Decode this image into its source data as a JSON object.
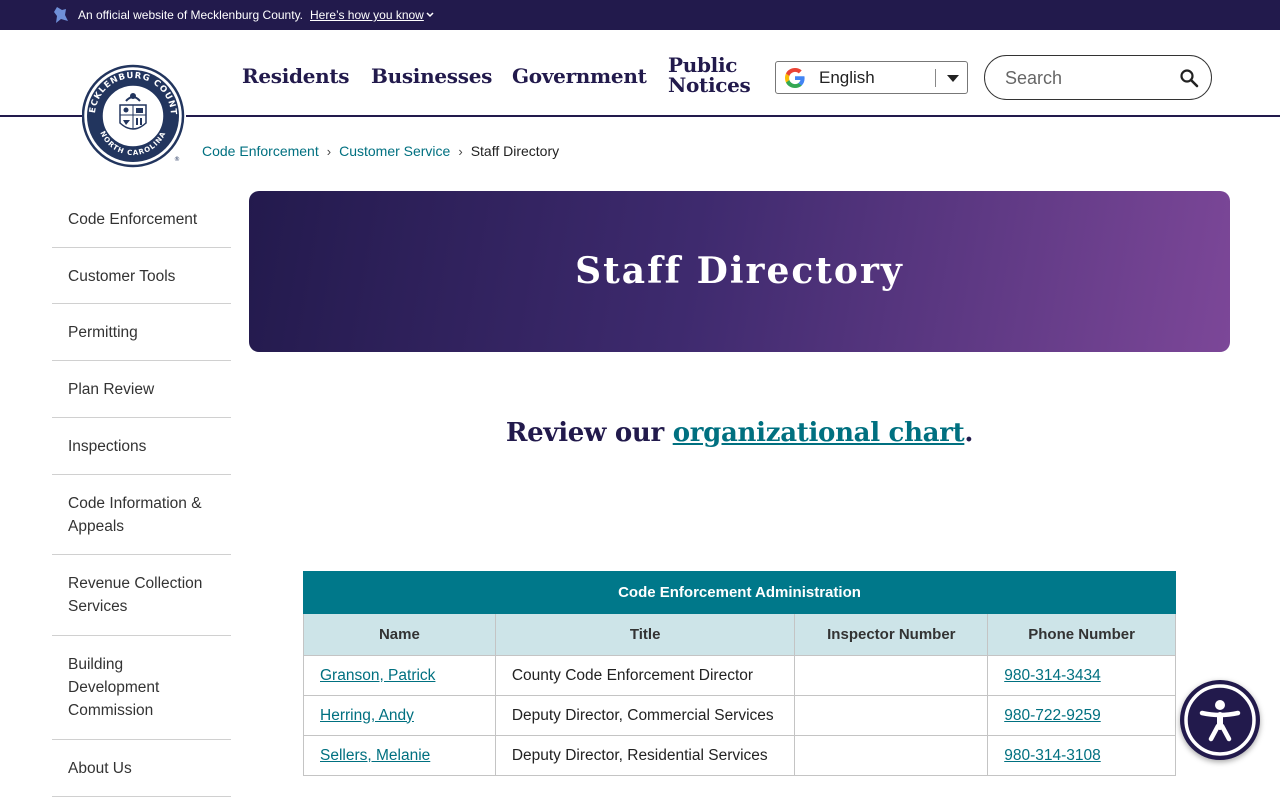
{
  "official_bar": {
    "text": "An official website of Mecklenburg County.",
    "link": "Here’s how you know"
  },
  "header": {
    "nav": {
      "residents": "Residents",
      "businesses": "Businesses",
      "government": "Government",
      "public_line1": "Public",
      "public_line2": "Notices"
    },
    "translate": {
      "selected": "English"
    },
    "search": {
      "placeholder": "Search"
    }
  },
  "breadcrumb": {
    "items": [
      "Code Enforcement",
      "Customer Service"
    ],
    "current": "Staff Directory"
  },
  "sidebar": {
    "items": [
      {
        "label": "Code Enforcement"
      },
      {
        "label": "Customer Tools"
      },
      {
        "label": "Permitting"
      },
      {
        "label": "Plan Review"
      },
      {
        "label": "Inspections"
      },
      {
        "label": "Code Information & Appeals"
      },
      {
        "label": "Revenue Collection Services"
      },
      {
        "label": "Building Development Commission"
      },
      {
        "label": "About Us"
      }
    ]
  },
  "hero": {
    "title": "Staff Directory"
  },
  "review": {
    "prefix": "Review our ",
    "link": "organizational chart",
    "suffix": "."
  },
  "table": {
    "caption": "Code Enforcement Administration",
    "columns": [
      "Name",
      "Title",
      "Inspector Number",
      "Phone Number"
    ],
    "rows": [
      {
        "name": "Granson, Patrick",
        "title": "County Code Enforcement Director",
        "inspector": "",
        "phone": "980-314-3434"
      },
      {
        "name": "Herring, Andy",
        "title": "Deputy Director, Commercial Services",
        "inspector": "",
        "phone": "980-722-9259"
      },
      {
        "name": "Sellers, Melanie",
        "title": "Deputy Director, Residential Services",
        "inspector": "",
        "phone": "980-314-3108"
      }
    ]
  },
  "icons": {
    "flag": "flag-icon",
    "chevron": "chevron-down-icon",
    "google": "google-g-icon",
    "search": "search-icon",
    "accessibility": "accessibility-icon",
    "seal": "county-seal-logo"
  },
  "seal_text": {
    "top": "MECKLENBURG COUNTY",
    "bottom": "NORTH CAROLINA"
  },
  "colors": {
    "brand_navy": "#221a4c",
    "link_teal": "#007080",
    "table_header": "#00788a",
    "table_subheader": "#cde4e8",
    "hero_end": "#7c4798"
  }
}
